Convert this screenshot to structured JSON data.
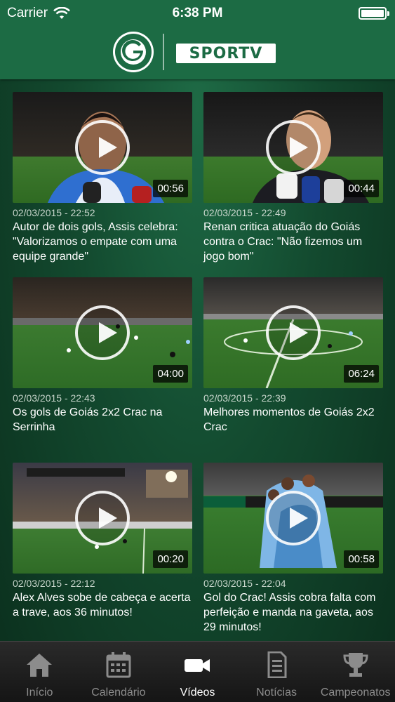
{
  "status_bar": {
    "carrier": "Carrier",
    "time": "6:38 PM"
  },
  "header": {
    "club_logo": "goias-esporte-clube-crest",
    "partner_logo": "SPORTV"
  },
  "videos": [
    {
      "timestamp": "02/03/2015 - 22:52",
      "title": "Autor de dois gols, Assis celebra: \"Valorizamos o empate com uma equipe grande\"",
      "duration": "00:56"
    },
    {
      "timestamp": "02/03/2015 - 22:49",
      "title": "Renan critica atuação do Goiás contra o Crac: \"Não fizemos um jogo bom\"",
      "duration": "00:44"
    },
    {
      "timestamp": "02/03/2015 - 22:43",
      "title": "Os gols de Goiás 2x2 Crac na Serrinha",
      "duration": "04:00"
    },
    {
      "timestamp": "02/03/2015 - 22:39",
      "title": "Melhores momentos de Goiás 2x2 Crac",
      "duration": "06:24"
    },
    {
      "timestamp": "02/03/2015 - 22:12",
      "title": "Alex Alves sobe de cabeça e acerta a trave, aos 36 minutos!",
      "duration": "00:20"
    },
    {
      "timestamp": "02/03/2015 - 22:04",
      "title": "Gol do Crac! Assis cobra falta com perfeição e manda na gaveta, aos 29 minutos!",
      "duration": "00:58"
    }
  ],
  "tabs": [
    {
      "label": "Início",
      "icon": "home-icon",
      "active": false
    },
    {
      "label": "Calendário",
      "icon": "calendar-icon",
      "active": false
    },
    {
      "label": "Vídeos",
      "icon": "video-camera-icon",
      "active": true
    },
    {
      "label": "Notícias",
      "icon": "document-icon",
      "active": false
    },
    {
      "label": "Campeonatos",
      "icon": "trophy-icon",
      "active": false
    }
  ],
  "colors": {
    "header": "#1c6b44",
    "background": "#134a2f",
    "tabbar": "#1e1e1e",
    "active_tab": "#ffffff",
    "inactive_tab": "#8c8c8c"
  }
}
